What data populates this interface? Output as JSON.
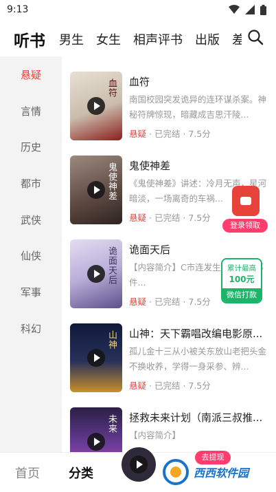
{
  "status_bar": {
    "time": "9:13",
    "icons": [
      "wifi-icon",
      "signal-icon",
      "battery-icon"
    ]
  },
  "top_tabs": [
    {
      "label": "听书",
      "active": true
    },
    {
      "label": "男生"
    },
    {
      "label": "女生"
    },
    {
      "label": "相声评书"
    },
    {
      "label": "出版"
    },
    {
      "label": "差"
    }
  ],
  "sidebar": [
    {
      "label": "悬疑",
      "active": true
    },
    {
      "label": "言情"
    },
    {
      "label": "历史"
    },
    {
      "label": "都市"
    },
    {
      "label": "武侠"
    },
    {
      "label": "仙侠"
    },
    {
      "label": "军事"
    },
    {
      "label": "科幻"
    }
  ],
  "books": [
    {
      "title": "血符",
      "desc": "南国校园突发诡异的连环谋杀案。神秘符牌惊现，暗藏成吉思汗陵...",
      "genre": "悬疑",
      "status": "已完结",
      "score": "7.5分",
      "cover_text": "血符",
      "cover_color": "#d9d0c4"
    },
    {
      "title": "鬼使神差",
      "desc": "《鬼使神差》讲述：冷月无声，星河暗淡，一场离奇的车祸...",
      "genre": "悬疑",
      "status": "已完结",
      "score": "7.5分",
      "cover_text": "鬼使神差",
      "cover_color": "#6d5a52"
    },
    {
      "title": "诡面天后",
      "desc": "【内容简介】C市连发生恶性死亡事件...",
      "genre": "悬疑",
      "status": "已完结",
      "score": "7.5分",
      "cover_text": "诡面天后",
      "cover_color": "#b9aed8"
    },
    {
      "title": "山神：天下霸唱改编电影原...",
      "desc": "孤儿金十三从小被关东放山老把头金不换收养，学得一身采参、辨...",
      "genre": "悬疑",
      "status": "已完结",
      "score": "7.5分",
      "cover_text": "山神",
      "cover_color": "#1d2240"
    },
    {
      "title": "拯救未来计划（南派三叔推...",
      "desc": "【内容简介】",
      "genre": "",
      "status": "",
      "score": "",
      "cover_text": "未来",
      "cover_color": "#3a2a55"
    }
  ],
  "redpack": {
    "label": "登录领取"
  },
  "reward": {
    "line1": "累计最高",
    "line2": "100元",
    "foot": "微信打款"
  },
  "bottom_nav": [
    {
      "label": "首页"
    },
    {
      "label": "分类",
      "active": true
    }
  ],
  "withdraw": {
    "label": "去提现"
  },
  "watermark": {
    "text": "西西软件园"
  }
}
